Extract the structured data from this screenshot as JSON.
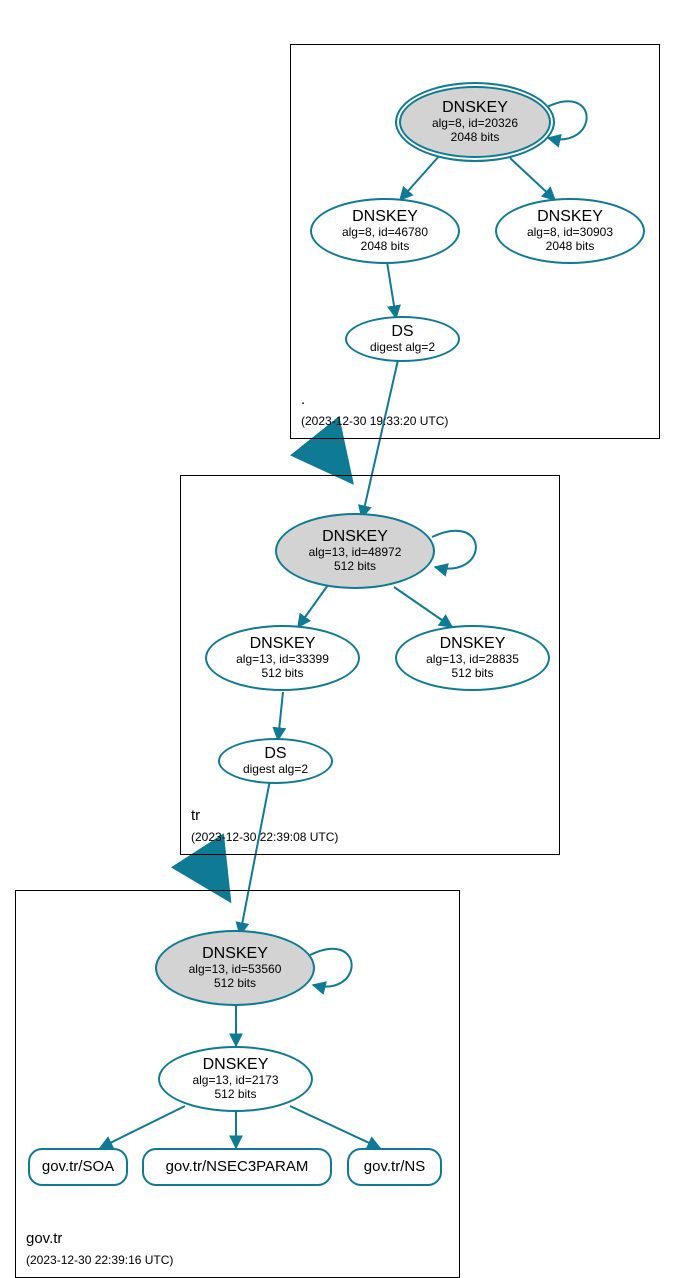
{
  "colors": {
    "border": "#0e7a94",
    "node_fill": "#d3d3d3",
    "box_border": "#000000"
  },
  "zones": {
    "root": {
      "name": ".",
      "timestamp": "(2023-12-30 19:33:20 UTC)"
    },
    "tr": {
      "name": "tr",
      "timestamp": "(2023-12-30 22:39:08 UTC)"
    },
    "govtr": {
      "name": "gov.tr",
      "timestamp": "(2023-12-30 22:39:16 UTC)"
    }
  },
  "nodes": {
    "root_ksk": {
      "title": "DNSKEY",
      "line2": "alg=8, id=20326",
      "line3": "2048 bits"
    },
    "root_zsk1": {
      "title": "DNSKEY",
      "line2": "alg=8, id=46780",
      "line3": "2048 bits"
    },
    "root_zsk2": {
      "title": "DNSKEY",
      "line2": "alg=8, id=30903",
      "line3": "2048 bits"
    },
    "root_ds": {
      "title": "DS",
      "line2": "digest alg=2"
    },
    "tr_ksk": {
      "title": "DNSKEY",
      "line2": "alg=13, id=48972",
      "line3": "512 bits"
    },
    "tr_zsk1": {
      "title": "DNSKEY",
      "line2": "alg=13, id=33399",
      "line3": "512 bits"
    },
    "tr_zsk2": {
      "title": "DNSKEY",
      "line2": "alg=13, id=28835",
      "line3": "512 bits"
    },
    "tr_ds": {
      "title": "DS",
      "line2": "digest alg=2"
    },
    "gov_ksk": {
      "title": "DNSKEY",
      "line2": "alg=13, id=53560",
      "line3": "512 bits"
    },
    "gov_zsk": {
      "title": "DNSKEY",
      "line2": "alg=13, id=2173",
      "line3": "512 bits"
    },
    "rr_soa": {
      "title": "gov.tr/SOA"
    },
    "rr_nsec3": {
      "title": "gov.tr/NSEC3PARAM"
    },
    "rr_ns": {
      "title": "gov.tr/NS"
    }
  }
}
